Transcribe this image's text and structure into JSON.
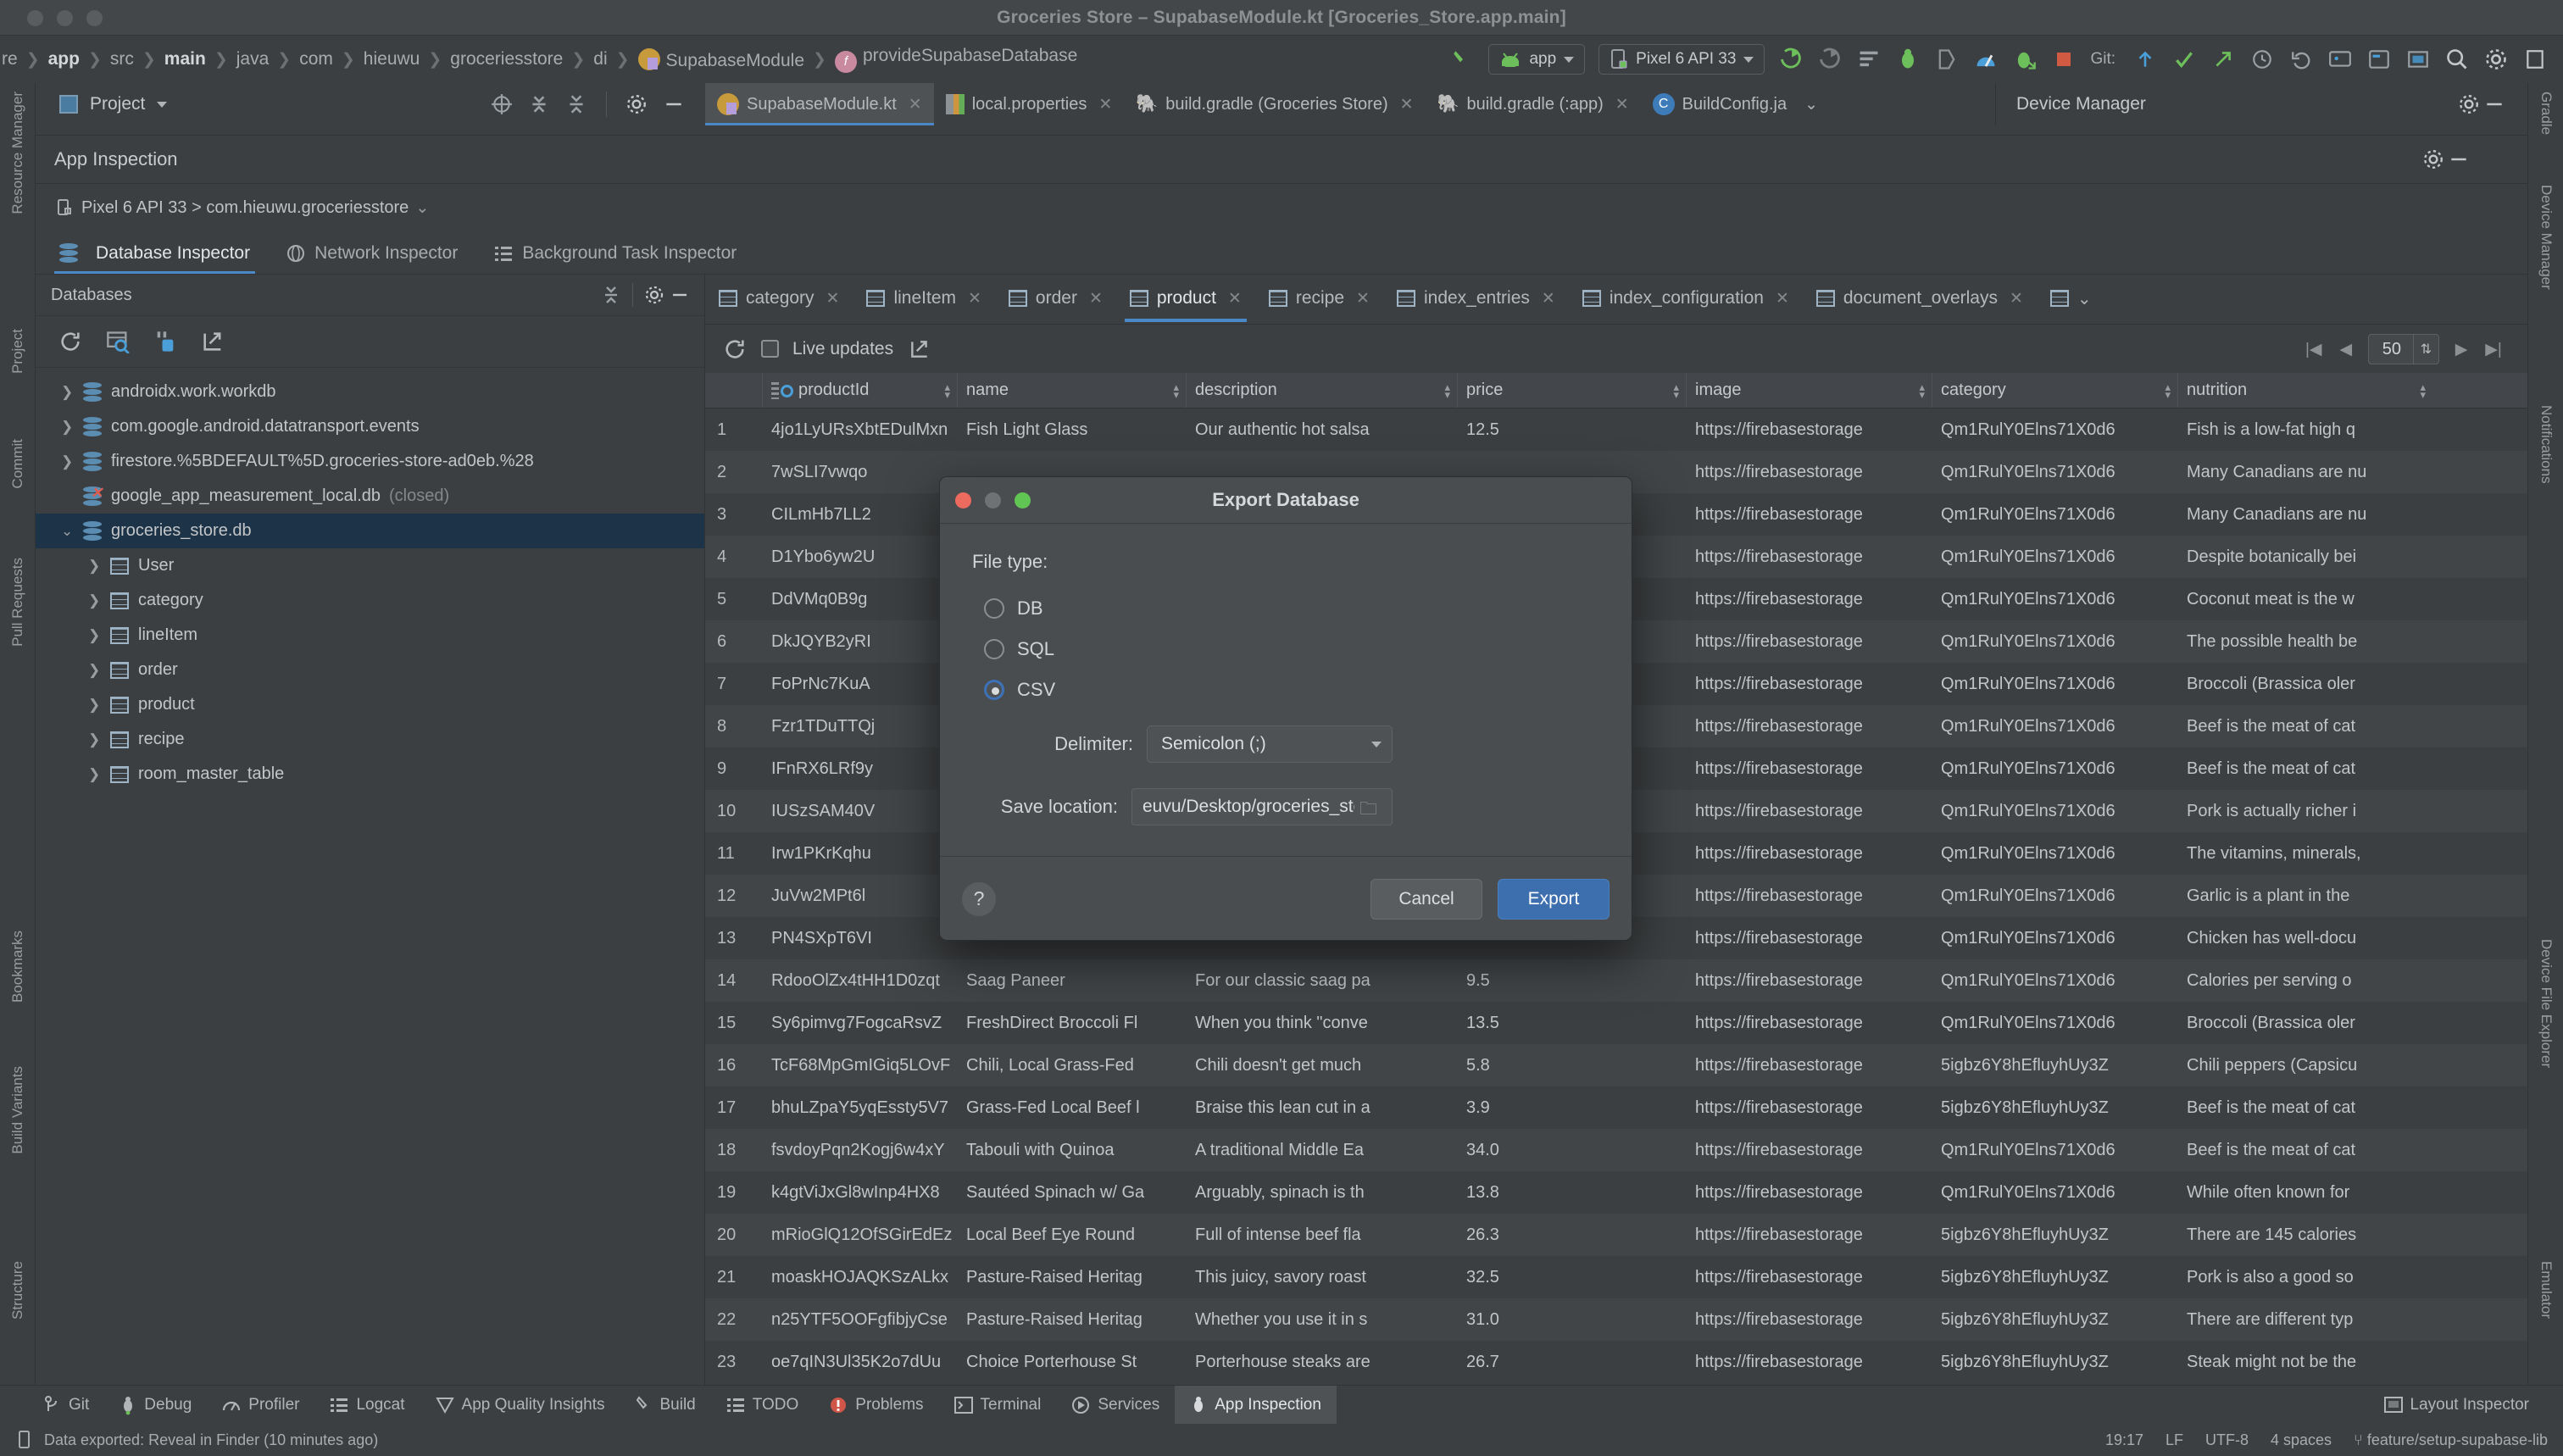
{
  "window": {
    "title": "Groceries Store – SupabaseModule.kt [Groceries_Store.app.main]"
  },
  "breadcrumb": {
    "items": [
      {
        "label": "re"
      },
      {
        "label": "app"
      },
      {
        "label": "src"
      },
      {
        "label": "main"
      },
      {
        "label": "java"
      },
      {
        "label": "com"
      },
      {
        "label": "hieuwu"
      },
      {
        "label": "groceriesstore"
      },
      {
        "label": "di"
      },
      {
        "label": "SupabaseModule"
      },
      {
        "label": "provideSupabaseDatabase"
      }
    ]
  },
  "toolbar": {
    "run_config": "app",
    "device": "Pixel 6 API 33",
    "git_label": "Git:"
  },
  "project_panel": {
    "title": "Project"
  },
  "editor_tabs": [
    {
      "label": "SupabaseModule.kt",
      "icon": "kotlin-file-icon",
      "active": true
    },
    {
      "label": "local.properties",
      "icon": "properties-file-icon",
      "active": false
    },
    {
      "label": "build.gradle (Groceries Store)",
      "icon": "gradle-file-icon",
      "active": false
    },
    {
      "label": "build.gradle (:app)",
      "icon": "gradle-file-icon",
      "active": false
    },
    {
      "label": "BuildConfig.ja",
      "icon": "class-file-icon",
      "active": false
    }
  ],
  "device_manager": {
    "title": "Device Manager"
  },
  "app_inspection": {
    "title": "App Inspection",
    "process": "Pixel 6 API 33 > com.hieuwu.groceriesstore",
    "tabs": [
      {
        "label": "Database Inspector",
        "active": true
      },
      {
        "label": "Network Inspector",
        "active": false
      },
      {
        "label": "Background Task Inspector",
        "active": false
      }
    ]
  },
  "databases": {
    "title": "Databases",
    "tree": [
      {
        "label": "androidx.work.workdb",
        "type": "db",
        "expanded": false,
        "indent": 0,
        "selected": false,
        "suffix": ""
      },
      {
        "label": "com.google.android.datatransport.events",
        "type": "db",
        "expanded": false,
        "indent": 0,
        "selected": false,
        "suffix": ""
      },
      {
        "label": "firestore.%5BDEFAULT%5D.groceries-store-ad0eb.%28",
        "type": "db",
        "expanded": false,
        "indent": 0,
        "selected": false,
        "suffix": ""
      },
      {
        "label": "google_app_measurement_local.db",
        "type": "db-closed",
        "expanded": null,
        "indent": 0,
        "selected": false,
        "suffix": "(closed)"
      },
      {
        "label": "groceries_store.db",
        "type": "db",
        "expanded": true,
        "indent": 0,
        "selected": true,
        "suffix": ""
      },
      {
        "label": "User",
        "type": "table",
        "expanded": false,
        "indent": 1,
        "selected": false,
        "suffix": ""
      },
      {
        "label": "category",
        "type": "table",
        "expanded": false,
        "indent": 1,
        "selected": false,
        "suffix": ""
      },
      {
        "label": "lineItem",
        "type": "table",
        "expanded": false,
        "indent": 1,
        "selected": false,
        "suffix": ""
      },
      {
        "label": "order",
        "type": "table",
        "expanded": false,
        "indent": 1,
        "selected": false,
        "suffix": ""
      },
      {
        "label": "product",
        "type": "table",
        "expanded": false,
        "indent": 1,
        "selected": false,
        "suffix": ""
      },
      {
        "label": "recipe",
        "type": "table",
        "expanded": false,
        "indent": 1,
        "selected": false,
        "suffix": ""
      },
      {
        "label": "room_master_table",
        "type": "table",
        "expanded": false,
        "indent": 1,
        "selected": false,
        "suffix": ""
      }
    ]
  },
  "table_tabs": [
    {
      "label": "category",
      "active": false
    },
    {
      "label": "lineItem",
      "active": false
    },
    {
      "label": "order",
      "active": false
    },
    {
      "label": "product",
      "active": true
    },
    {
      "label": "recipe",
      "active": false
    },
    {
      "label": "index_entries",
      "active": false
    },
    {
      "label": "index_configuration",
      "active": false
    },
    {
      "label": "document_overlays",
      "active": false
    }
  ],
  "grid_toolbar": {
    "live_updates_label": "Live updates",
    "live_updates_checked": false,
    "page_size": "50"
  },
  "grid": {
    "columns": [
      "productId",
      "name",
      "description",
      "price",
      "image",
      "category",
      "nutrition"
    ],
    "rows": [
      {
        "n": "1",
        "productId": "4jo1LyURsXbtEDulMxn",
        "name": "Fish Light Glass",
        "description": "Our authentic hot salsa",
        "price": "12.5",
        "image": "https://firebasestorage",
        "category": "Qm1RulY0Elns71X0d6",
        "nutrition": "Fish is a low-fat high q"
      },
      {
        "n": "2",
        "productId": "7wSLI7vwqo",
        "name": "",
        "description": "",
        "price": "",
        "image": "https://firebasestorage",
        "category": "Qm1RulY0Elns71X0d6",
        "nutrition": "Many Canadians are nu"
      },
      {
        "n": "3",
        "productId": "CILmHb7LL2",
        "name": "",
        "description": "",
        "price": "",
        "image": "https://firebasestorage",
        "category": "Qm1RulY0Elns71X0d6",
        "nutrition": "Many Canadians are nu"
      },
      {
        "n": "4",
        "productId": "D1Ybo6yw2U",
        "name": "",
        "description": "",
        "price": "",
        "image": "https://firebasestorage",
        "category": "Qm1RulY0Elns71X0d6",
        "nutrition": "Despite botanically bei"
      },
      {
        "n": "5",
        "productId": "DdVMq0B9g",
        "name": "",
        "description": "",
        "price": "",
        "image": "https://firebasestorage",
        "category": "Qm1RulY0Elns71X0d6",
        "nutrition": "Coconut meat is the w"
      },
      {
        "n": "6",
        "productId": "DkJQYB2yRI",
        "name": "",
        "description": "",
        "price": "",
        "image": "https://firebasestorage",
        "category": "Qm1RulY0Elns71X0d6",
        "nutrition": "The possible health be"
      },
      {
        "n": "7",
        "productId": "FoPrNc7KuA",
        "name": "",
        "description": "",
        "price": "",
        "image": "https://firebasestorage",
        "category": "Qm1RulY0Elns71X0d6",
        "nutrition": "Broccoli (Brassica oler"
      },
      {
        "n": "8",
        "productId": "Fzr1TDuTTQj",
        "name": "",
        "description": "",
        "price": "",
        "image": "https://firebasestorage",
        "category": "Qm1RulY0Elns71X0d6",
        "nutrition": "Beef is the meat of cat"
      },
      {
        "n": "9",
        "productId": "IFnRX6LRf9y",
        "name": "",
        "description": "",
        "price": "",
        "image": "https://firebasestorage",
        "category": "Qm1RulY0Elns71X0d6",
        "nutrition": "Beef is the meat of cat"
      },
      {
        "n": "10",
        "productId": "IUSzSAM40V",
        "name": "",
        "description": "",
        "price": "",
        "image": "https://firebasestorage",
        "category": "Qm1RulY0Elns71X0d6",
        "nutrition": "Pork is actually richer i"
      },
      {
        "n": "11",
        "productId": "Irw1PKrKqhu",
        "name": "",
        "description": "",
        "price": "",
        "image": "https://firebasestorage",
        "category": "Qm1RulY0Elns71X0d6",
        "nutrition": "The vitamins, minerals,"
      },
      {
        "n": "12",
        "productId": "JuVw2MPt6l",
        "name": "",
        "description": "",
        "price": "",
        "image": "https://firebasestorage",
        "category": "Qm1RulY0Elns71X0d6",
        "nutrition": "Garlic is a plant in the"
      },
      {
        "n": "13",
        "productId": "PN4SXpT6VI",
        "name": "",
        "description": "",
        "price": "",
        "image": "https://firebasestorage",
        "category": "Qm1RulY0Elns71X0d6",
        "nutrition": "Chicken has well-docu"
      },
      {
        "n": "14",
        "productId": "RdooOlZx4tHH1D0zqt",
        "name": "Saag Paneer",
        "description": "For our classic saag pa",
        "price": "9.5",
        "image": "https://firebasestorage",
        "category": "Qm1RulY0Elns71X0d6",
        "nutrition": "Calories per serving o"
      },
      {
        "n": "15",
        "productId": "Sy6pimvg7FogcaRsvZ",
        "name": "FreshDirect Broccoli Fl",
        "description": "When you think \"conve",
        "price": "13.5",
        "image": "https://firebasestorage",
        "category": "Qm1RulY0Elns71X0d6",
        "nutrition": "Broccoli (Brassica oler"
      },
      {
        "n": "16",
        "productId": "TcF68MpGmIGiq5LOvF",
        "name": "Chili, Local Grass-Fed",
        "description": "Chili doesn't get much",
        "price": "5.8",
        "image": "https://firebasestorage",
        "category": "5igbz6Y8hEfluyhUy3Z",
        "nutrition": "Chili peppers (Capsicu"
      },
      {
        "n": "17",
        "productId": "bhuLZpaY5yqEssty5V7",
        "name": "Grass-Fed Local Beef l",
        "description": "Braise this lean cut in a",
        "price": "3.9",
        "image": "https://firebasestorage",
        "category": "5igbz6Y8hEfluyhUy3Z",
        "nutrition": "Beef is the meat of cat"
      },
      {
        "n": "18",
        "productId": "fsvdoyPqn2Kogj6w4xY",
        "name": "Tabouli with Quinoa",
        "description": "A traditional Middle Ea",
        "price": "34.0",
        "image": "https://firebasestorage",
        "category": "Qm1RulY0Elns71X0d6",
        "nutrition": "Beef is the meat of cat"
      },
      {
        "n": "19",
        "productId": "k4gtViJxGl8wInp4HX8",
        "name": "Sautéed Spinach w/ Ga",
        "description": "Arguably, spinach is th",
        "price": "13.8",
        "image": "https://firebasestorage",
        "category": "Qm1RulY0Elns71X0d6",
        "nutrition": "While often known for"
      },
      {
        "n": "20",
        "productId": "mRioGlQ12OfSGirEdEz",
        "name": "Local Beef Eye Round ",
        "description": "Full of intense beef fla",
        "price": "26.3",
        "image": "https://firebasestorage",
        "category": "5igbz6Y8hEfluyhUy3Z",
        "nutrition": "There are 145 calories"
      },
      {
        "n": "21",
        "productId": "moaskHOJAQKSzALkx",
        "name": "Pasture-Raised Heritag",
        "description": "This juicy, savory roast",
        "price": "32.5",
        "image": "https://firebasestorage",
        "category": "5igbz6Y8hEfluyhUy3Z",
        "nutrition": "Pork is also a good so"
      },
      {
        "n": "22",
        "productId": "n25YTF5OOFgfibjyCse",
        "name": "Pasture-Raised Heritag",
        "description": "Whether you use it in s",
        "price": "31.0",
        "image": "https://firebasestorage",
        "category": "5igbz6Y8hEfluyhUy3Z",
        "nutrition": "There are different typ"
      },
      {
        "n": "23",
        "productId": "oe7qIN3Ul35K2o7dUu",
        "name": "Choice Porterhouse St",
        "description": "Porterhouse steaks are",
        "price": "26.7",
        "image": "https://firebasestorage",
        "category": "5igbz6Y8hEfluyhUy3Z",
        "nutrition": "Steak might not be the"
      }
    ]
  },
  "export_dialog": {
    "title": "Export Database",
    "file_type_label": "File type:",
    "options": [
      {
        "label": "DB",
        "selected": false
      },
      {
        "label": "SQL",
        "selected": false
      },
      {
        "label": "CSV",
        "selected": true
      }
    ],
    "delimiter_label": "Delimiter:",
    "delimiter_value": "Semicolon (;)",
    "save_location_label": "Save location:",
    "save_location_value": "euvu/Desktop/groceries_store_db.zip",
    "help_label": "?",
    "cancel_label": "Cancel",
    "export_label": "Export"
  },
  "bottom_bar": {
    "items": [
      {
        "label": "Git",
        "icon": "git-icon",
        "active": false
      },
      {
        "label": "Debug",
        "icon": "debug-icon",
        "active": false
      },
      {
        "label": "Profiler",
        "icon": "profiler-icon",
        "active": false
      },
      {
        "label": "Logcat",
        "icon": "logcat-icon",
        "active": false
      },
      {
        "label": "App Quality Insights",
        "icon": "insights-icon",
        "active": false
      },
      {
        "label": "Build",
        "icon": "build-icon",
        "active": false
      },
      {
        "label": "TODO",
        "icon": "todo-icon",
        "active": false
      },
      {
        "label": "Problems",
        "icon": "problems-icon",
        "active": false
      },
      {
        "label": "Terminal",
        "icon": "terminal-icon",
        "active": false
      },
      {
        "label": "Services",
        "icon": "services-icon",
        "active": false
      },
      {
        "label": "App Inspection",
        "icon": "app-inspection-icon",
        "active": true
      }
    ],
    "layout_inspector": "Layout Inspector"
  },
  "status_bar": {
    "message": "Data exported: Reveal in Finder (10 minutes ago)",
    "caret": "19:17",
    "line_sep": "LF",
    "encoding": "UTF-8",
    "indent": "4 spaces",
    "branch": "feature/setup-supabase-lib"
  },
  "left_rail": [
    "Resource Manager",
    "Project",
    "Commit",
    "Pull Requests",
    "Bookmarks",
    "Build Variants",
    "Structure"
  ],
  "right_rail": [
    "Gradle",
    "Device Manager",
    "Notifications",
    "Device File Explorer",
    "Emulator"
  ]
}
